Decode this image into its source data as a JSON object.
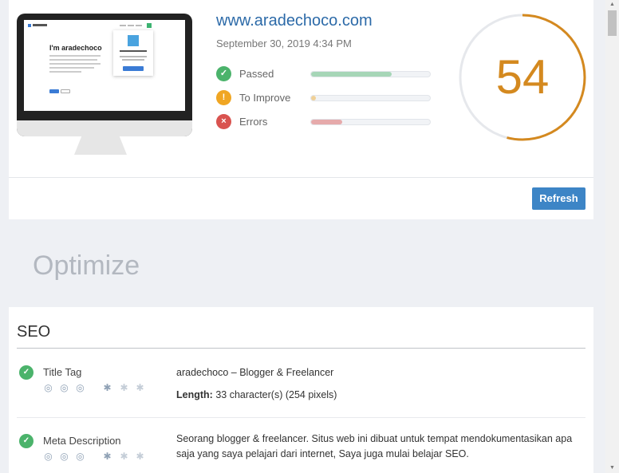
{
  "report": {
    "site_url": "www.aradechoco.com",
    "date": "September 30, 2019 4:34 PM",
    "score": "54",
    "score_fraction": 0.54,
    "score_color": "#d4891f",
    "refresh_label": "Refresh"
  },
  "preview": {
    "hero_title": "I'm aradechoco"
  },
  "stats": [
    {
      "label": "Passed",
      "icon": "check-icon",
      "color": "#4bb36b",
      "fill_percent": 68
    },
    {
      "label": "To Improve",
      "icon": "exclamation-icon",
      "color": "#f0a623",
      "fill_percent": 4
    },
    {
      "label": "Errors",
      "icon": "x-icon",
      "color": "#d9534f",
      "fill_percent": 26
    }
  ],
  "optimize": {
    "heading": "Optimize"
  },
  "seo": {
    "title": "SEO",
    "items": [
      {
        "name": "Title Tag",
        "value": "aradechoco – Blogger & Freelancer",
        "length_label": "Length:",
        "length_value": "33 character(s) (254 pixels)"
      },
      {
        "name": "Meta Description",
        "value": "Seorang blogger & freelancer. Situs web ini dibuat untuk tempat mendokumentasikan apa saja yang saya pelajari dari internet, Saya juga mulai belajar SEO."
      }
    ]
  }
}
